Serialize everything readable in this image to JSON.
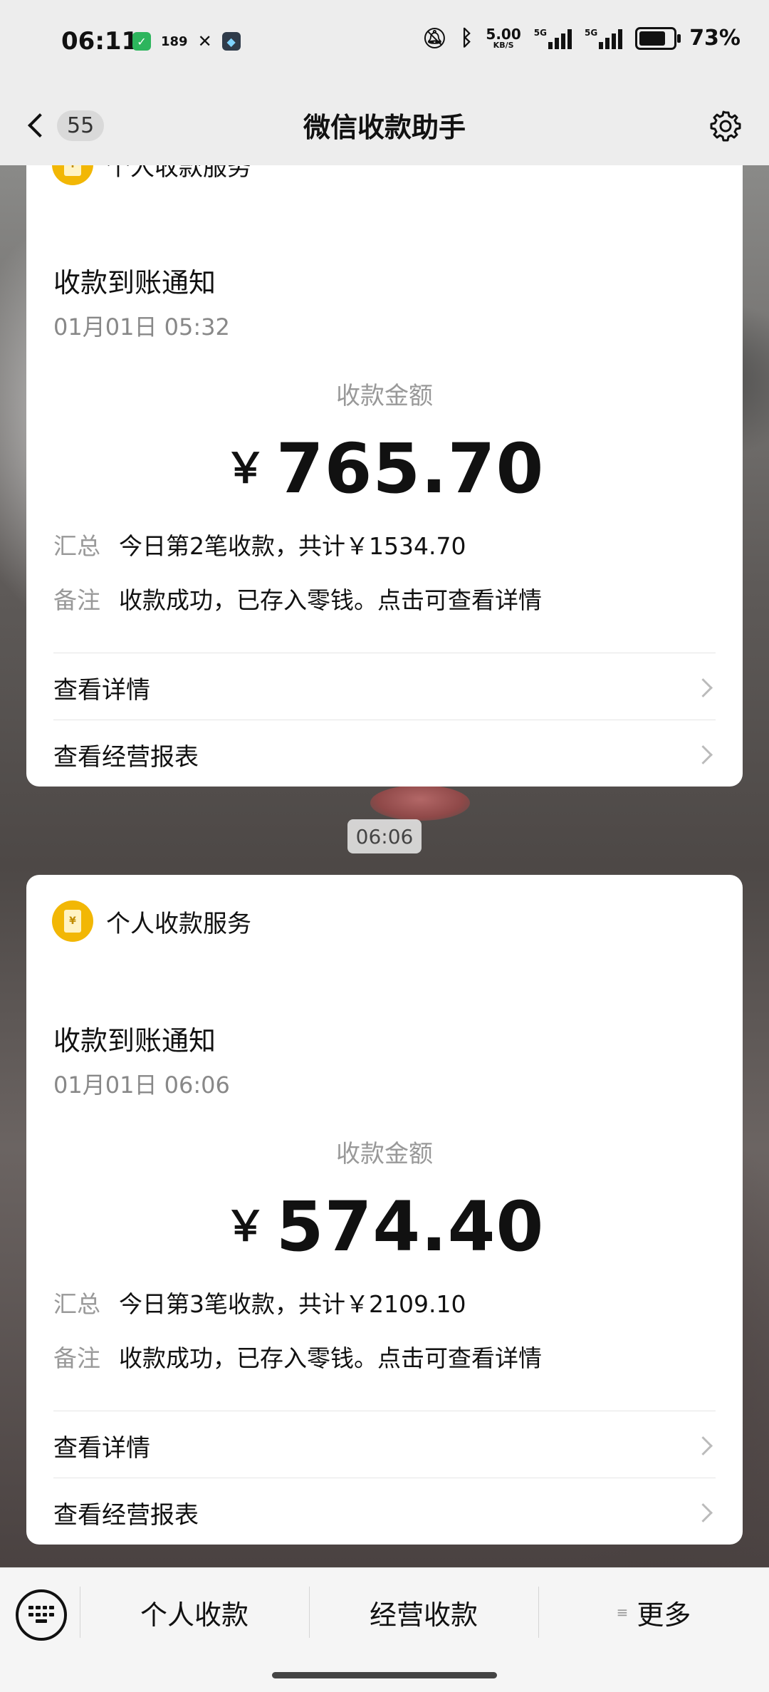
{
  "status_bar": {
    "time": "06:11",
    "icon_189": "189",
    "net_speed": "5.00",
    "net_unit": "KB/S",
    "signal1": "5G",
    "signal2": "5G",
    "battery": "73%"
  },
  "nav": {
    "back_count": "55",
    "title": "微信收款助手"
  },
  "cards": [
    {
      "service": "个人收款服务",
      "title": "收款到账通知",
      "time": "01月01日 05:32",
      "amount_label": "收款金额",
      "currency": "￥",
      "amount": "765.70",
      "summary_key": "汇总",
      "summary_value": "今日第2笔收款，共计￥1534.70",
      "note_key": "备注",
      "note_value": "收款成功，已存入零钱。点击可查看详情",
      "link1": "查看详情",
      "link2": "查看经营报表"
    },
    {
      "service": "个人收款服务",
      "title": "收款到账通知",
      "time": "01月01日 06:06",
      "amount_label": "收款金额",
      "currency": "￥",
      "amount": "574.40",
      "summary_key": "汇总",
      "summary_value": "今日第3笔收款，共计￥2109.10",
      "note_key": "备注",
      "note_value": "收款成功，已存入零钱。点击可查看详情",
      "link1": "查看详情",
      "link2": "查看经营报表"
    }
  ],
  "time_pill": "06:06",
  "bottom": {
    "tab1": "个人收款",
    "tab2": "经营收款",
    "tab3": "更多",
    "tab3_marker": "≡"
  },
  "colors": {
    "bar_bg": "#ededed",
    "service_icon": "#f2b705",
    "card_bg": "#ffffff",
    "muted_text": "#999999"
  }
}
